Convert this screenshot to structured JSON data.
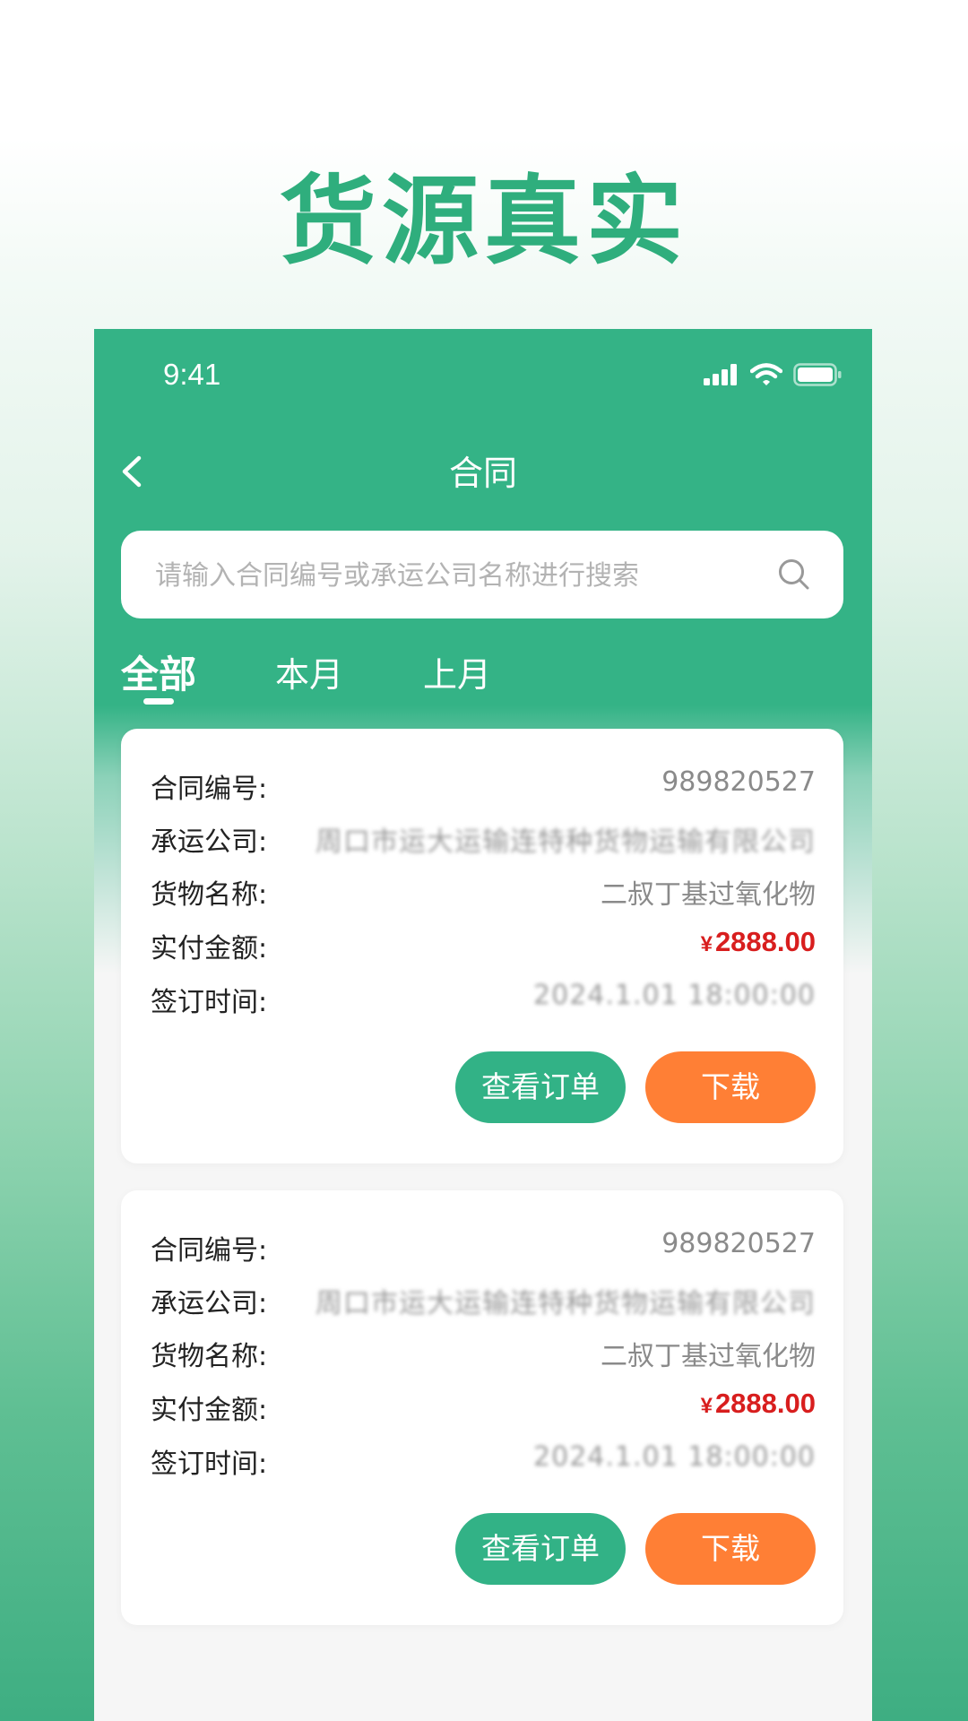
{
  "hero": {
    "title": "货源真实"
  },
  "status_bar": {
    "time": "9:41"
  },
  "nav": {
    "title": "合同"
  },
  "search": {
    "placeholder": "请输入合同编号或承运公司名称进行搜索"
  },
  "tabs": [
    {
      "label": "全部",
      "active": true
    },
    {
      "label": "本月",
      "active": false
    },
    {
      "label": "上月",
      "active": false
    }
  ],
  "cards": [
    {
      "rows": [
        {
          "label": "合同编号:",
          "value": "989820527"
        },
        {
          "label": "承运公司:",
          "value": "周口市运大运输连特种货物运输有限公司"
        },
        {
          "label": "货物名称:",
          "value": "二叔丁基过氧化物"
        },
        {
          "label": "实付金额:",
          "currency": "¥",
          "value": "2888.00"
        },
        {
          "label": "签订时间:",
          "value": "2024.1.01 18:00:00"
        }
      ],
      "buttons": {
        "view": "查看订单",
        "download": "下载"
      }
    },
    {
      "rows": [
        {
          "label": "合同编号:",
          "value": "989820527"
        },
        {
          "label": "承运公司:",
          "value": "周口市运大运输连特种货物运输有限公司"
        },
        {
          "label": "货物名称:",
          "value": "二叔丁基过氧化物"
        },
        {
          "label": "实付金额:",
          "currency": "¥",
          "value": "2888.00"
        },
        {
          "label": "签订时间:",
          "value": "2024.1.01 18:00:00"
        }
      ],
      "buttons": {
        "view": "查看订单",
        "download": "下载"
      }
    }
  ],
  "colors": {
    "primary_green": "#34b386",
    "accent_orange": "#ff7f35",
    "price_red": "#d81e1e",
    "hero_green": "#2fae7d"
  },
  "icons": {
    "back": "chevron-left-icon",
    "search": "search-icon",
    "signal": "signal-icon",
    "wifi": "wifi-icon",
    "battery": "battery-icon"
  }
}
